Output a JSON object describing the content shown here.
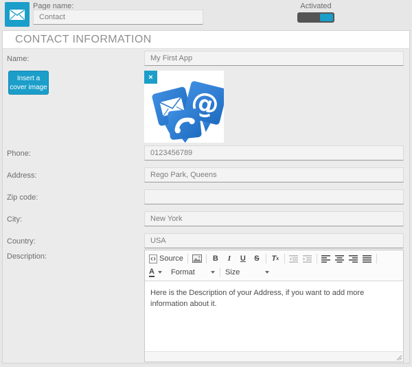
{
  "colors": {
    "accent": "#1b9ec9",
    "bubble_blue": "#2d7fd4"
  },
  "topbar": {
    "page_name_label": "Page name:",
    "page_name_value": "Contact",
    "activated_label": "Activated",
    "toggle_state": "on"
  },
  "header": {
    "title": "CONTACT INFORMATION"
  },
  "cover": {
    "button_label": "Insert a cover image",
    "remove_icon": "×",
    "image_description": "three blue chat bubbles with envelope, at-sign and phone icons"
  },
  "form": {
    "name_label": "Name:",
    "name_value": "My First App",
    "phone_label": "Phone:",
    "phone_value": "0123456789",
    "address_label": "Address:",
    "address_value": "Rego Park, Queens",
    "zip_label": "Zip code:",
    "zip_value": "",
    "city_label": "City:",
    "city_value": "New York",
    "country_label": "Country:",
    "country_value": "USA",
    "description_label": "Description:"
  },
  "editor": {
    "source_label": "Source",
    "bold_label": "B",
    "italic_label": "I",
    "underline_label": "U",
    "strike_label": "S",
    "removeformat_label": "T",
    "removeformat_sub": "x",
    "color_label": "A",
    "format_label": "Format",
    "size_label": "Size",
    "content": "Here is the Description of your Address, if you want to add more information about it."
  }
}
